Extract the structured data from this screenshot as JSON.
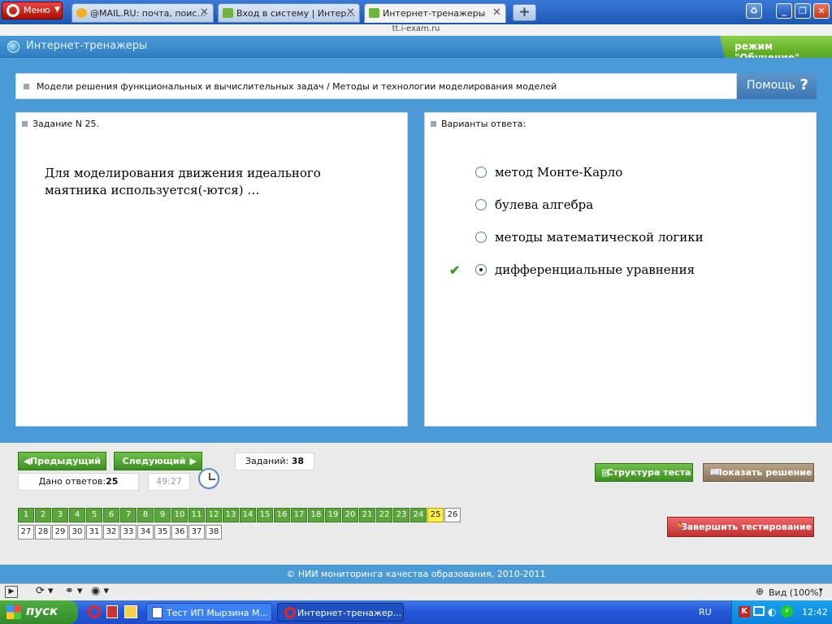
{
  "browser": {
    "menu_label": "Меню",
    "tabs": [
      {
        "title": "@MAIL.RU: почта, поис...",
        "active": false
      },
      {
        "title": "Вход в систему | Интер...",
        "active": false
      },
      {
        "title": "Интернет-тренажеры",
        "active": true
      }
    ],
    "new_tab_label": "+",
    "url": "tt.i-exam.ru"
  },
  "header": {
    "title": "Интернет-тренажеры",
    "mode_label": "режим \"Обучение\""
  },
  "breadcrumb": "Модели решения функциональных и вычислительных задач / Методы и технологии моделирования моделей",
  "help_label": "Помощь",
  "help_icon": "?",
  "task": {
    "header": "Задание N 25.",
    "question": "Для моделирования движения идеального маятника используется(-ются) …"
  },
  "answers": {
    "header": "Варианты ответа:",
    "options": [
      {
        "label": "метод Монте-Карло",
        "selected": false
      },
      {
        "label": "булева алгебра",
        "selected": false
      },
      {
        "label": "методы математической логики",
        "selected": false
      },
      {
        "label": "дифференциальные уравнения",
        "selected": true
      }
    ]
  },
  "nav": {
    "prev_label": "Предыдущий",
    "next_label": "Следующий",
    "answered_label": "Дано ответов:",
    "answered_value": "25",
    "timer": "49:27",
    "total_label": "Заданий:",
    "total_value": "38",
    "structure_label": "Структура теста",
    "solution_label": "Показать решение",
    "finish_label": "Завершить тестирование",
    "current": 25,
    "answered_count": 24,
    "numbers": [
      "1",
      "2",
      "3",
      "4",
      "5",
      "6",
      "7",
      "8",
      "9",
      "10",
      "11",
      "12",
      "13",
      "14",
      "15",
      "16",
      "17",
      "18",
      "19",
      "20",
      "21",
      "22",
      "23",
      "24",
      "25",
      "26",
      "27",
      "28",
      "29",
      "30",
      "31",
      "32",
      "33",
      "34",
      "35",
      "36",
      "37",
      "38"
    ]
  },
  "footer": "© НИИ мониторинга качества образования, 2010-2011",
  "statusbar": {
    "zoom_label": "Вид (100%)"
  },
  "taskbar": {
    "start_label": "пуск",
    "tasks": [
      "Тест ИП Мырзина М...",
      "Интернет-тренажер..."
    ],
    "lang": "RU",
    "time": "12:42"
  },
  "colors": {
    "accent_blue": "#4a9ad8",
    "mode_green": "#6fbf4a",
    "answered_green": "#5aa63a",
    "current_yellow": "#ffee44",
    "finish_red": "#c22e2e"
  }
}
